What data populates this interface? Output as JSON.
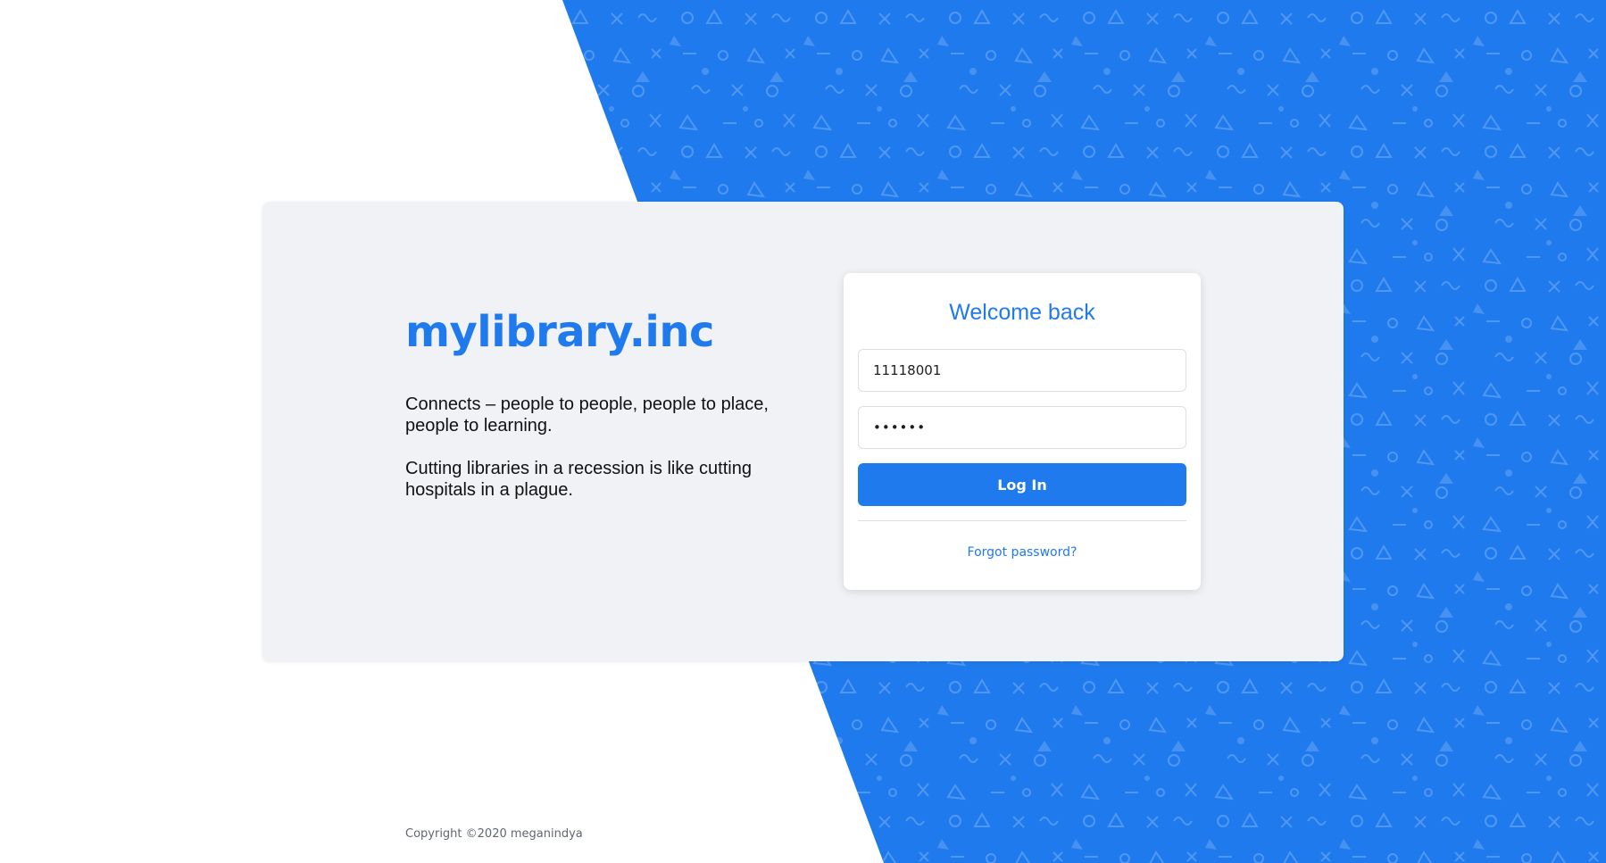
{
  "background": {
    "accent_color": "#1f7aed",
    "pattern": "geometric-shapes"
  },
  "brand": {
    "title": "mylibrary.inc",
    "tagline_1": "Connects – people to people, people to place, people to learning.",
    "tagline_2": "Cutting libraries in a recession is like cutting hospitals in a plague."
  },
  "login": {
    "heading": "Welcome back",
    "username_value": "11118001",
    "password_value": "••••••",
    "login_button": "Log In",
    "forgot_link": "Forgot password?"
  },
  "footer": {
    "copyright": "Copyright ©2020 meganindya"
  }
}
